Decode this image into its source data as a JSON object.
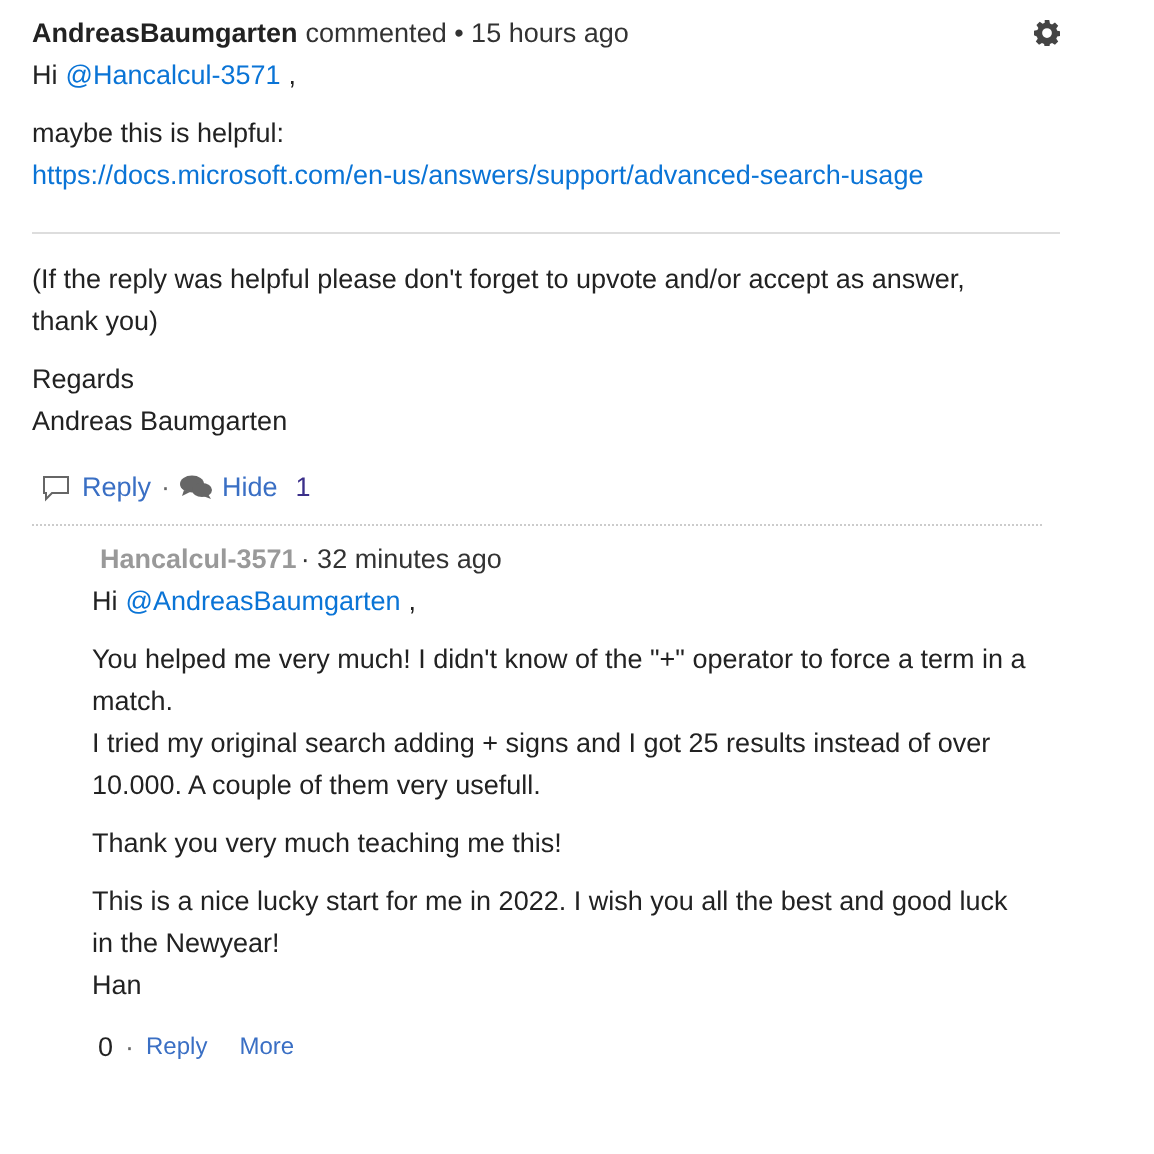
{
  "comment": {
    "author": "AndreasBaumgarten",
    "action": "commented",
    "time": "• 15 hours ago",
    "greeting": {
      "prefix": "Hi",
      "mention": "@Hancalcul-3571",
      "suffix": ","
    },
    "link_intro": "maybe this is helpful:",
    "link": "https://docs.microsoft.com/en-us/answers/support/advanced-search-usage",
    "note_lines": [
      "(If the reply was helpful please don't forget to upvote and/or accept as answer, thank you)"
    ],
    "signature_lines": [
      "Regards",
      "Andreas Baumgarten"
    ],
    "actions": {
      "reply": "Reply",
      "separator": "·",
      "hide": "Hide",
      "count": "1"
    }
  },
  "reply": {
    "author": "Hancalcul-3571",
    "time": "· 32 minutes ago",
    "greeting": {
      "prefix": "Hi",
      "mention": "@AndreasBaumgarten",
      "suffix": ","
    },
    "paragraphs": [
      [
        "You helped me very much! I didn't know of the \"+\" operator to force a term in a match.",
        "I tried my original search adding + signs and I got 25 results instead of over 10.000. A couple of them very usefull."
      ],
      [
        "Thank you very much teaching me this!"
      ],
      [
        "This is a nice lucky start for me in 2022. I wish you all the best and good luck in the Newyear!",
        "Han"
      ]
    ],
    "actions": {
      "votes": "0",
      "separator": "·",
      "reply": "Reply",
      "more": "More"
    }
  }
}
